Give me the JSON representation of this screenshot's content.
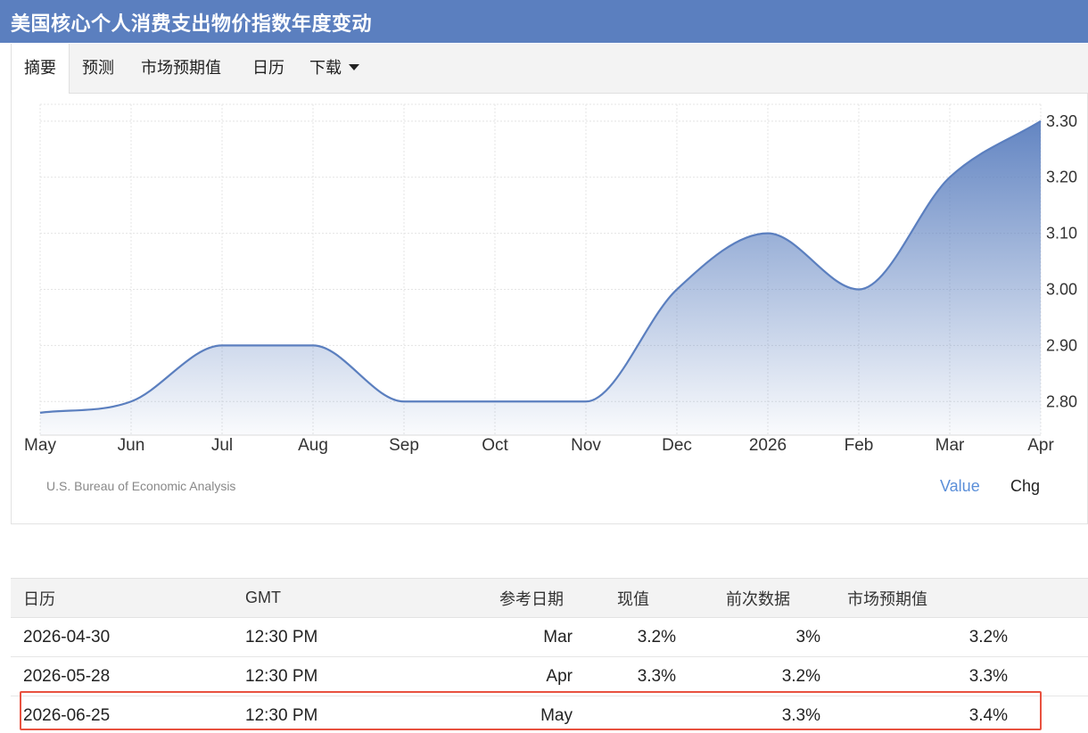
{
  "title": "美国核心个人消费支出物价指数年度变动",
  "tabs": [
    {
      "label": "摘要"
    },
    {
      "label": "预测"
    },
    {
      "label": "市场预期值"
    },
    {
      "label": "日历"
    },
    {
      "label": "下载"
    }
  ],
  "chart_data": {
    "type": "area",
    "categories": [
      "May",
      "Jun",
      "Jul",
      "Aug",
      "Sep",
      "Oct",
      "Nov",
      "Dec",
      "2026",
      "Feb",
      "Mar",
      "Apr"
    ],
    "series": [
      {
        "values": [
          2.78,
          2.8,
          2.9,
          2.9,
          2.8,
          2.8,
          2.8,
          3.0,
          3.1,
          3.0,
          3.2,
          3.3
        ]
      }
    ],
    "y_ticks": [
      "2.80",
      "2.90",
      "3.00",
      "3.10",
      "3.20",
      "3.30"
    ],
    "ylim": [
      2.74,
      3.33
    ],
    "y_axis_position": "right",
    "grid": true,
    "color": "#5b7fbf"
  },
  "source": "U.S. Bureau of Economic Analysis",
  "toggles": {
    "value": "Value",
    "chg": "Chg"
  },
  "table": {
    "headers": [
      "日历",
      "GMT",
      "参考日期",
      "现值",
      "前次数据",
      "市场预期值"
    ],
    "rows": [
      {
        "date": "2026-04-30",
        "time": "12:30 PM",
        "ref": "Mar",
        "actual": "3.2%",
        "previous": "3%",
        "consensus": "3.2%"
      },
      {
        "date": "2026-05-28",
        "time": "12:30 PM",
        "ref": "Apr",
        "actual": "3.3%",
        "previous": "3.2%",
        "consensus": "3.3%"
      },
      {
        "date": "2026-06-25",
        "time": "12:30 PM",
        "ref": "May",
        "actual": "",
        "previous": "3.3%",
        "consensus": "3.4%"
      }
    ]
  },
  "highlight_color": "#e8513f"
}
